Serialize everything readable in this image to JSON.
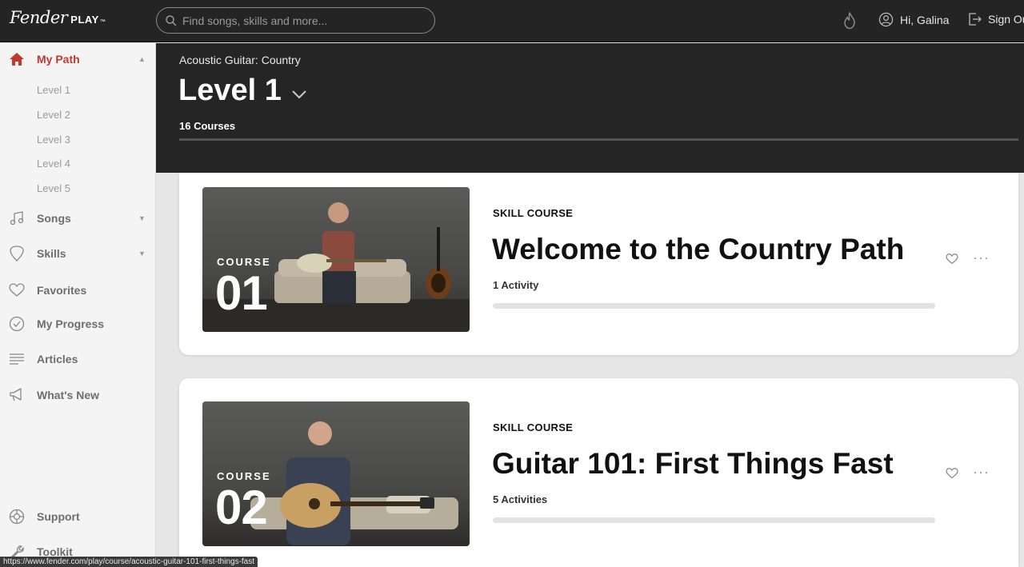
{
  "topbar": {
    "logo_script": "Fender",
    "logo_play": "PLAY",
    "logo_tm": "™",
    "search_placeholder": "Find songs, skills and more...",
    "greeting": "Hi, Galina",
    "signout": "Sign Out"
  },
  "sidebar": {
    "my_path": "My Path",
    "levels": [
      "Level 1",
      "Level 2",
      "Level 3",
      "Level 4",
      "Level 5"
    ],
    "songs": "Songs",
    "skills": "Skills",
    "favorites": "Favorites",
    "my_progress": "My Progress",
    "articles": "Articles",
    "whats_new": "What's New",
    "support": "Support",
    "toolkit": "Toolkit"
  },
  "header": {
    "breadcrumb": "Acoustic Guitar: Country",
    "level_title": "Level 1",
    "courses_count": "16 Courses"
  },
  "courses": [
    {
      "badge_word": "COURSE",
      "number": "01",
      "kind": "SKILL COURSE",
      "title": "Welcome to the Country Path",
      "activities": "1 Activity",
      "progress": 0
    },
    {
      "badge_word": "COURSE",
      "number": "02",
      "kind": "SKILL COURSE",
      "title": "Guitar 101: First Things Fast",
      "activities": "5 Activities",
      "progress": 0
    }
  ],
  "status_url": "https://www.fender.com/play/course/acoustic-guitar-101-first-things-fast",
  "colors": {
    "accent": "#c0392b",
    "topbar": "#242424",
    "header": "#252525"
  }
}
